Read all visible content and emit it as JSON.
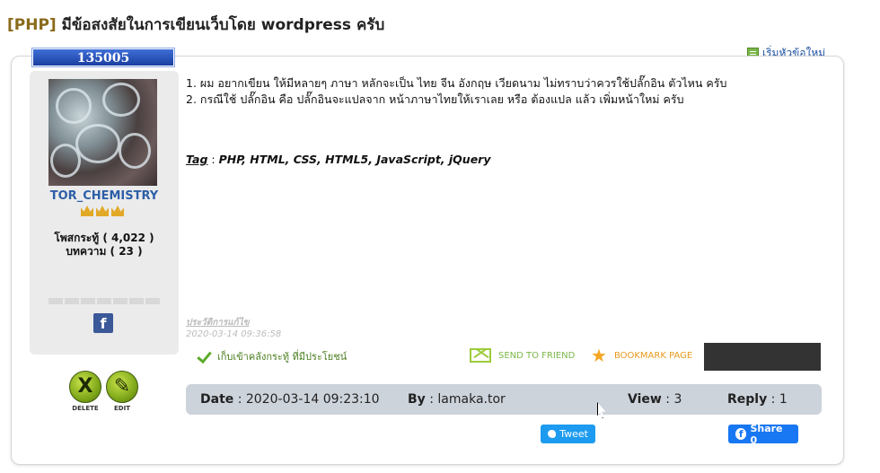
{
  "topic": {
    "category_tag": "[PHP]",
    "title": "มีข้อสงสัยในการเขียนเว็บโดย wordpress ครับ",
    "new_topic_label": "เริ่มหัวข้อใหม่"
  },
  "post": {
    "id": "135005",
    "lines": [
      "1. ผม อยากเขียน ให้มีหลายๆ ภาษา หลักจะเป็น ไทย จีน อังกฤษ เวียดนาม ไม่ทราบว่าควรใช้ปลั๊กอิน ตัวไหน ครับ",
      "2. กรณีใช้ ปลั๊กอิน คือ ปลั๊กอินจะแปลจาก หน้าภาษาไทยให้เราเลย หรือ ต้องแปล แล้ว เพิ่มหน้าใหม่ ครับ"
    ],
    "tag_label": "Tag",
    "tag_sep": " : ",
    "tags": "PHP, HTML, CSS, HTML5, JavaScript, jQuery",
    "edit_history_label": "ประวัติการแก้ไข",
    "edit_timestamp": "2020-03-14 09:36:58"
  },
  "author": {
    "username": "TOR_CHEMISTRY",
    "crowns": 3,
    "posts_line": "โพสกระทู้ ( 4,022 )",
    "articles_line": "บทความ ( 23 )",
    "facebook_icon": "facebook-icon"
  },
  "moderation": {
    "delete_label": "DELETE",
    "edit_label": "EDIT"
  },
  "actions": {
    "save_favorite": "เก็บเข้าคลังกระทู้ ที่มีประโยชน์",
    "send_to_friend": "SEND TO FRIEND",
    "bookmark": "BOOKMARK PAGE"
  },
  "info": {
    "date_label": "Date",
    "date_value": "2020-03-14 09:23:10",
    "by_label": "By",
    "by_value": "lamaka.tor",
    "view_label": "View",
    "view_value": "3",
    "reply_label": "Reply",
    "reply_value": "1"
  },
  "share": {
    "tweet_label": "Tweet",
    "fb_label": "Share 0"
  },
  "colors": {
    "accent_blue": "#2d5fa8",
    "tag_brown": "#8a6a1a",
    "green": "#7ab648",
    "orange": "#e89a1c",
    "info_bar": "#cdd3db"
  }
}
